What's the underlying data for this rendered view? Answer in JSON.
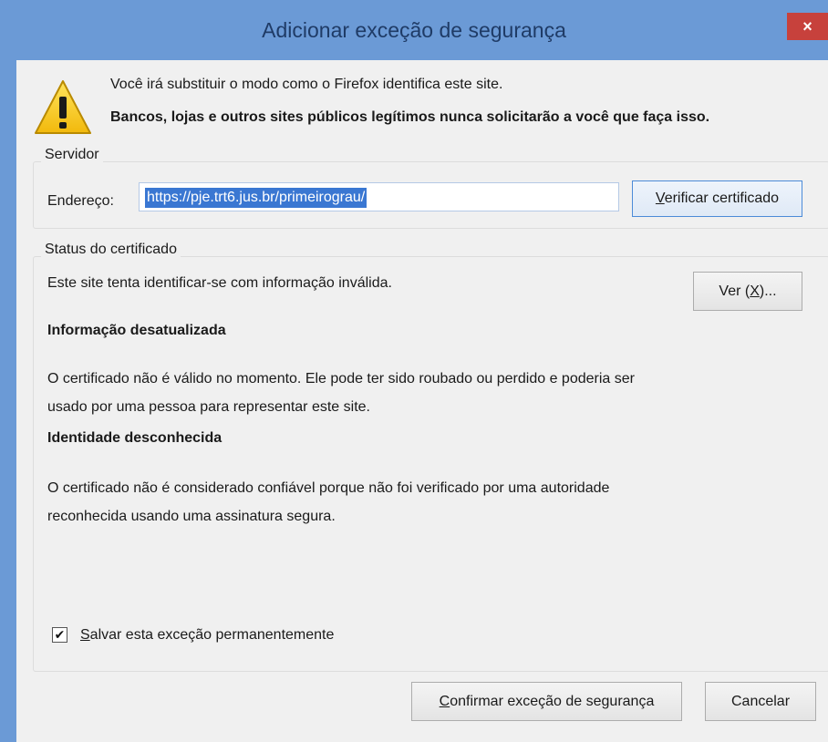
{
  "window": {
    "title": "Adicionar exceção de segurança",
    "close_glyph": "×"
  },
  "warning": {
    "icon": "warning-triangle-icon",
    "line1": "Você irá substituir o modo como o Firefox identifica este site.",
    "line2": "Bancos, lojas e outros sites públicos legítimos nunca solicitarão a você que faça isso."
  },
  "server": {
    "group_label": "Servidor",
    "address_label": "Endereço:",
    "address_value": "https://pje.trt6.jus.br/primeirograu/",
    "verify_button": {
      "accel": "V",
      "rest": "erificar certificado"
    }
  },
  "status": {
    "group_label": "Status do certificado",
    "summary": "Este site tenta identificar-se com informação inválida.",
    "view_button": {
      "before": "Ver (",
      "accel": "X",
      "after": ")..."
    },
    "section1_title": "Informação desatualizada",
    "section1_line1": "O certificado não é válido no momento. Ele pode ter sido roubado ou perdido e poderia ser",
    "section1_line2": "usado por uma pessoa para representar este site.",
    "section2_title": "Identidade desconhecida",
    "section2_line1": "O certificado não é considerado confiável porque não foi verificado por uma autoridade",
    "section2_line2": "reconhecida usando uma assinatura segura."
  },
  "save_permanent": {
    "checked": true,
    "check_glyph": "✔",
    "accel": "S",
    "rest": "alvar esta exceção permanentemente"
  },
  "footer": {
    "confirm_button": {
      "accel": "C",
      "rest": "onfirmar exceção de segurança"
    },
    "cancel_button": "Cancelar"
  },
  "colors": {
    "titlebar": "#6b9ad6",
    "close": "#c7413c",
    "selection": "#3a77d2",
    "dialog_bg": "#f0f0f0"
  }
}
